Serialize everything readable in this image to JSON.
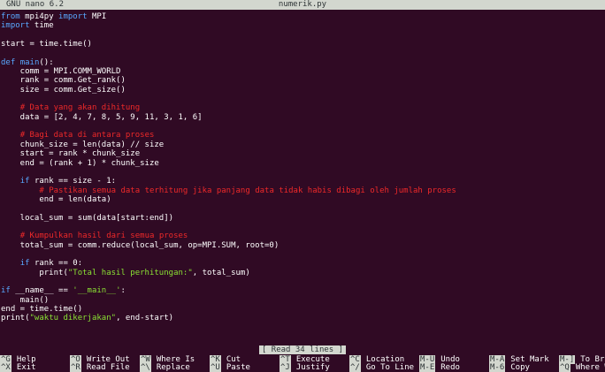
{
  "titlebar": {
    "app": "GNU nano 6.2",
    "filename": "numerik.py"
  },
  "code": [
    [
      {
        "t": "from",
        "c": "kw"
      },
      {
        "t": " mpi4py "
      },
      {
        "t": "import",
        "c": "kw"
      },
      {
        "t": " MPI"
      }
    ],
    [
      {
        "t": "import",
        "c": "kw"
      },
      {
        "t": " time"
      }
    ],
    [],
    [
      {
        "t": "start = time.time()"
      }
    ],
    [],
    [
      {
        "t": "def",
        "c": "kw"
      },
      {
        "t": " "
      },
      {
        "t": "main",
        "c": "kw"
      },
      {
        "t": "():"
      }
    ],
    [
      {
        "t": "    comm = MPI.COMM_WORLD"
      }
    ],
    [
      {
        "t": "    rank = comm.Get_rank()"
      }
    ],
    [
      {
        "t": "    size = comm.Get_size()"
      }
    ],
    [],
    [
      {
        "t": "    "
      },
      {
        "t": "# Data yang akan dihitung",
        "c": "cm"
      }
    ],
    [
      {
        "t": "    data = [2, 4, 7, 8, 5, 9, 11, 3, 1, 6]"
      }
    ],
    [],
    [
      {
        "t": "    "
      },
      {
        "t": "# Bagi data di antara proses",
        "c": "cm"
      }
    ],
    [
      {
        "t": "    chunk_size = len(data) // size"
      }
    ],
    [
      {
        "t": "    start = rank * chunk_size"
      }
    ],
    [
      {
        "t": "    end = (rank + 1) * chunk_size"
      }
    ],
    [],
    [
      {
        "t": "    "
      },
      {
        "t": "if",
        "c": "kw"
      },
      {
        "t": " rank == size - 1:"
      }
    ],
    [
      {
        "t": "        "
      },
      {
        "t": "# Pastikan semua data terhitung jika panjang data tidak habis dibagi oleh jumlah proses",
        "c": "cm"
      }
    ],
    [
      {
        "t": "        end = len(data)"
      }
    ],
    [],
    [
      {
        "t": "    local_sum = sum(data[start:end])"
      }
    ],
    [],
    [
      {
        "t": "    "
      },
      {
        "t": "# Kumpulkan hasil dari semua proses",
        "c": "cm"
      }
    ],
    [
      {
        "t": "    total_sum = comm.reduce(local_sum, op=MPI.SUM, root=0)"
      }
    ],
    [],
    [
      {
        "t": "    "
      },
      {
        "t": "if",
        "c": "kw"
      },
      {
        "t": " rank == 0:"
      }
    ],
    [
      {
        "t": "        print("
      },
      {
        "t": "\"Total hasil perhitungan:\"",
        "c": "st"
      },
      {
        "t": ", total_sum)"
      }
    ],
    [],
    [
      {
        "t": "if",
        "c": "kw"
      },
      {
        "t": " __name__ == "
      },
      {
        "t": "'__main__'",
        "c": "st"
      },
      {
        "t": ":"
      }
    ],
    [
      {
        "t": "    main()"
      }
    ],
    [
      {
        "t": "end = time.time()"
      }
    ],
    [
      {
        "t": "print("
      },
      {
        "t": "\"waktu dikerjakan\"",
        "c": "st"
      },
      {
        "t": ", end-start)"
      }
    ]
  ],
  "status_message": "[ Read 34 lines ]",
  "shortcuts": [
    {
      "key": "^G",
      "label": "Help",
      "icon": "help-icon"
    },
    {
      "key": "^O",
      "label": "Write Out",
      "icon": "write-out-icon"
    },
    {
      "key": "^W",
      "label": "Where Is",
      "icon": "where-is-icon"
    },
    {
      "key": "^K",
      "label": "Cut",
      "icon": "cut-icon"
    },
    {
      "key": "^T",
      "label": "Execute",
      "icon": "execute-icon"
    },
    {
      "key": "^C",
      "label": "Location",
      "icon": "location-icon"
    },
    {
      "key": "M-U",
      "label": "Undo",
      "icon": "undo-icon"
    },
    {
      "key": "M-A",
      "label": "Set Mark",
      "icon": "set-mark-icon"
    },
    {
      "key": "M-]",
      "label": "To Bra",
      "icon": "to-bracket-icon"
    },
    {
      "key": "^X",
      "label": "Exit",
      "icon": "exit-icon"
    },
    {
      "key": "^R",
      "label": "Read File",
      "icon": "read-file-icon"
    },
    {
      "key": "^\\",
      "label": "Replace",
      "icon": "replace-icon"
    },
    {
      "key": "^U",
      "label": "Paste",
      "icon": "paste-icon"
    },
    {
      "key": "^J",
      "label": "Justify",
      "icon": "justify-icon"
    },
    {
      "key": "^/",
      "label": "Go To Line",
      "icon": "go-to-line-icon"
    },
    {
      "key": "M-E",
      "label": "Redo",
      "icon": "redo-icon"
    },
    {
      "key": "M-6",
      "label": "Copy",
      "icon": "copy-icon"
    },
    {
      "key": "^Q",
      "label": "Where W",
      "icon": "where-was-icon"
    }
  ],
  "colors": {
    "background": "#300a24",
    "keyword": "#58a8ff",
    "comment": "#ef2929",
    "string": "#8ae234",
    "bar": "#d3d7cf"
  }
}
